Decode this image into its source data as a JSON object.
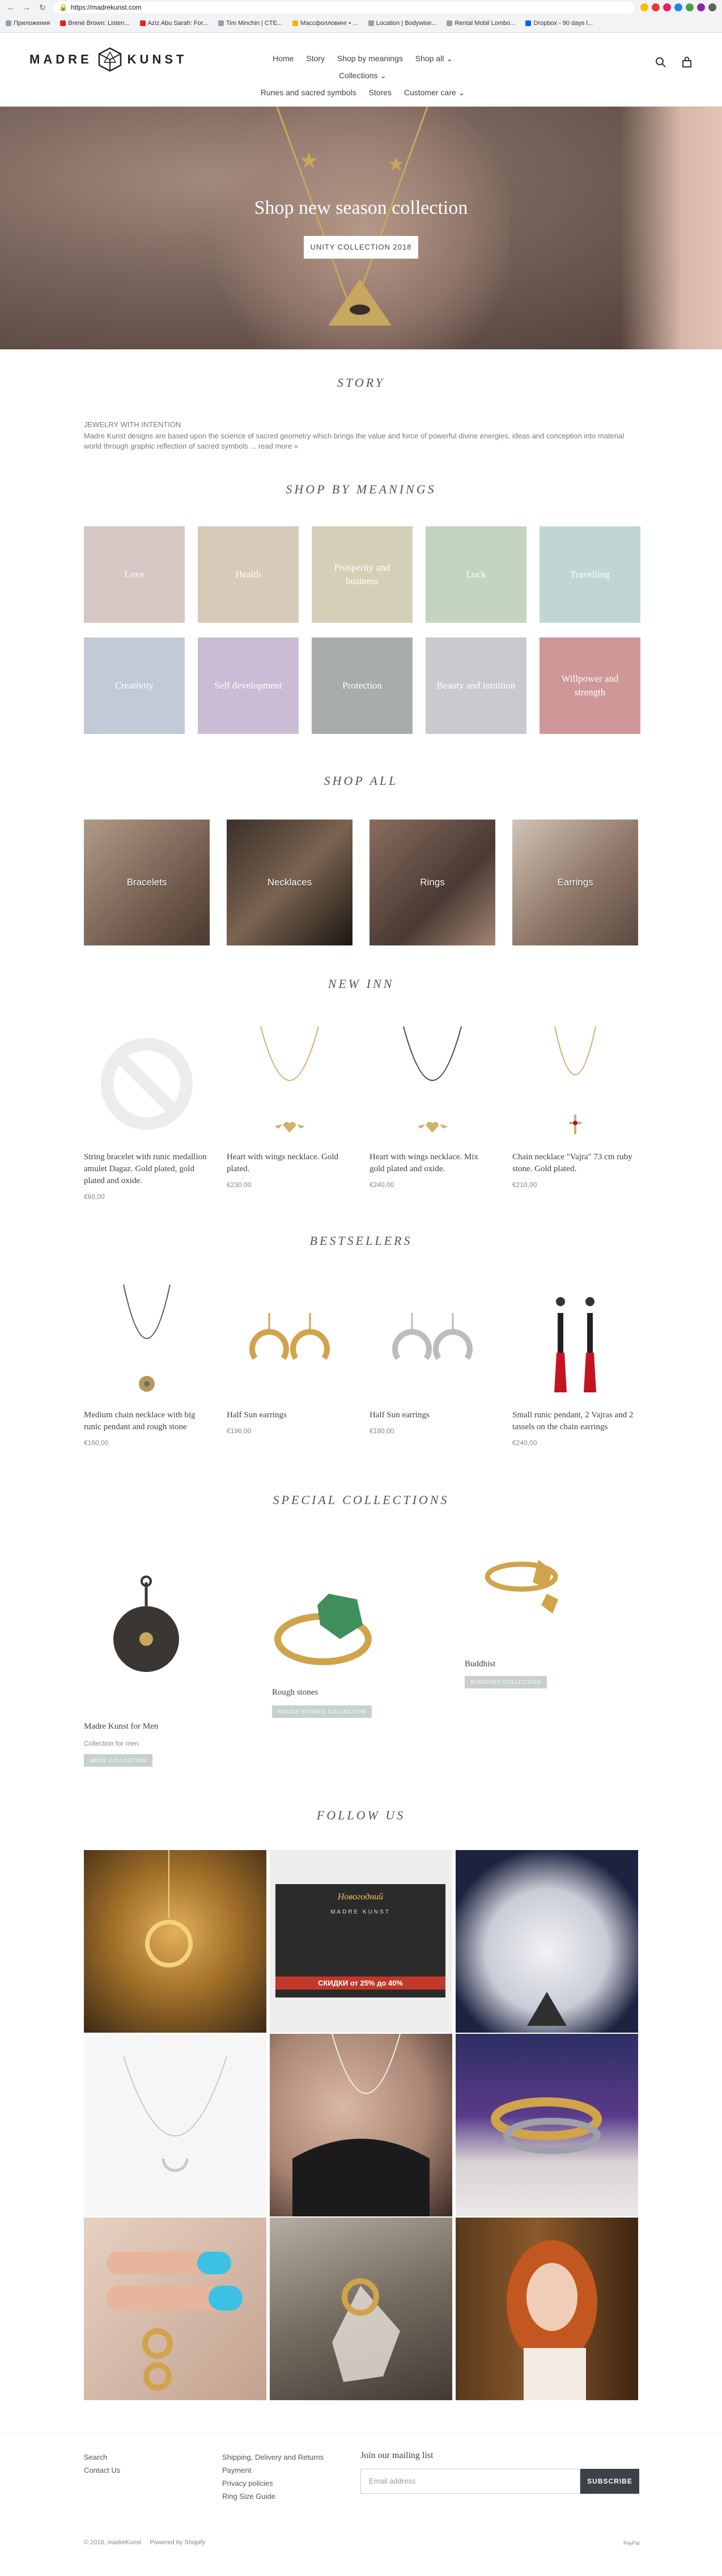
{
  "browser": {
    "url": "https://madrekunst.com",
    "bookmarks": [
      "Приложения",
      "Brené Brown: Listen...",
      "Aziz Abu Sarah: For...",
      "Tim Minchin | CTE...",
      "Массфолловинг • ...",
      "Location | Bodywise...",
      "Rental Mobil Lombo...",
      "Dropbox - 90 days l..."
    ]
  },
  "header": {
    "logo_left": "MADRE",
    "logo_right": "KUNST",
    "nav": [
      "Home",
      "Story",
      "Shop by meanings",
      "Shop all ⌄",
      "Collections ⌄",
      "Runes and sacred symbols",
      "Stores",
      "Customer care ⌄"
    ]
  },
  "hero": {
    "title": "Shop new season collection",
    "button": "UNITY COLLECTION 2018"
  },
  "story": {
    "title": "STORY",
    "line1": "JEWELRY WITH INTENTION",
    "text": "Madre Kunst designs are based upon the science of sacred geometry which brings the value and force of powerful divine energies, ideas and conception into material world through graphic reflection of sacred symbols ... read more »"
  },
  "meanings": {
    "title": "SHOP BY MEANINGS",
    "items": [
      {
        "label": "Love",
        "color": "#d5c8c4"
      },
      {
        "label": "Health",
        "color": "#d6cbb9"
      },
      {
        "label": "Prosperity and business",
        "color": "#d4d0b7"
      },
      {
        "label": "Luck",
        "color": "#c3d4bf"
      },
      {
        "label": "Travelling",
        "color": "#c1d6d4"
      },
      {
        "label": "Creativity",
        "color": "#c2cad8"
      },
      {
        "label": "Self development",
        "color": "#cbbcd5"
      },
      {
        "label": "Protection",
        "color": "#a9adaa"
      },
      {
        "label": "Beauty and intuition",
        "color": "#c9cacd"
      },
      {
        "label": "Willpower and strength",
        "color": "#cf9797"
      }
    ]
  },
  "shop_all": {
    "title": "SHOP ALL",
    "items": [
      "Bracelets",
      "Necklaces",
      "Rings",
      "Earrings"
    ]
  },
  "new_inn": {
    "title": "NEW INN",
    "items": [
      {
        "name": "String bracelet with runic medallion amulet Dagaz. Gold plated, gold plated and oxide.",
        "price": "€60,00"
      },
      {
        "name": "Heart with wings necklace. Gold plated.",
        "price": "€230,00"
      },
      {
        "name": "Heart with wings necklace. Mix gold plated and oxide.",
        "price": "€240,00"
      },
      {
        "name": "Chain necklace \"Vajra\" 73 cm ruby stone. Gold plated.",
        "price": "€210,00"
      }
    ]
  },
  "bestsellers": {
    "title": "BESTSELLERS",
    "items": [
      {
        "name": "Medium chain necklace with big runic pendant and rough stone",
        "price": "€160,00"
      },
      {
        "name": "Half Sun earrings",
        "price": "€196,00"
      },
      {
        "name": "Half Sun earrings",
        "price": "€180,00"
      },
      {
        "name": "Small runic pendant, 2 Vajras and 2 tassels on the chain earrings",
        "price": "€240,00"
      }
    ]
  },
  "special": {
    "title": "SPECIAL COLLECTIONS",
    "items": [
      {
        "title": "Madre Kunst for Men",
        "sub": "Collection for men",
        "tag": "MENS COLLECTION"
      },
      {
        "title": "Rough stones",
        "sub": "",
        "tag": "ROUGH STONES COLLECTION"
      },
      {
        "title": "Buddhist",
        "sub": "",
        "tag": "BUDDHIST COLLECTION"
      }
    ]
  },
  "follow": {
    "title": "FOLLOW US",
    "promo_line1": "Новогодний",
    "promo_brand": "MADRE KUNST",
    "promo_sale": "СКИДКИ от 25% до 40%"
  },
  "footer": {
    "col1": [
      "Search",
      "Contact Us"
    ],
    "col2": [
      "Shipping, Delivery and Returns",
      "Payment",
      "Privacy policies",
      "Ring Size Guide"
    ],
    "mailing_title": "Join our mailing list",
    "email_placeholder": "Email address",
    "subscribe": "SUBSCRIBE",
    "copyright": "© 2018, madreKunst",
    "powered": "Powered by Shopify",
    "payment": "PayPal"
  }
}
